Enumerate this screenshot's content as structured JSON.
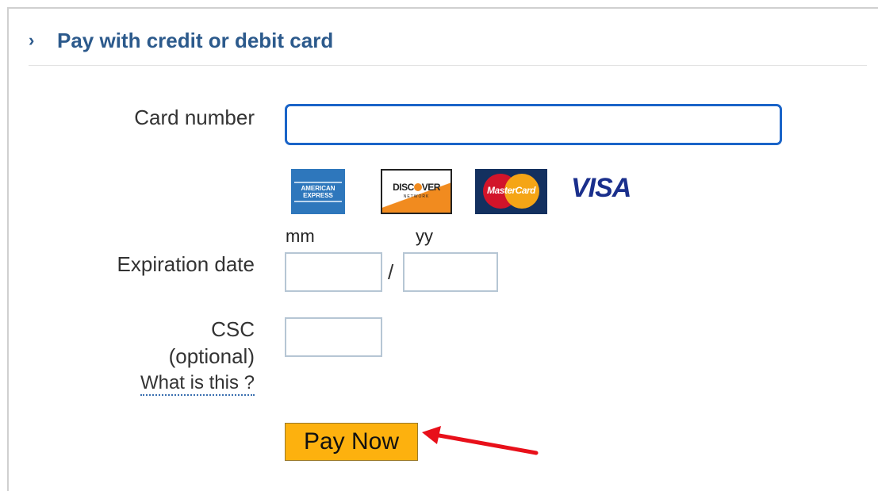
{
  "section": {
    "chevron": "›",
    "title": "Pay with credit or debit card"
  },
  "form": {
    "card_number_label": "Card number",
    "card_number_value": "",
    "expiration_label": "Expiration date",
    "mm_label": "mm",
    "yy_label": "yy",
    "separator": "/",
    "mm_value": "",
    "yy_value": "",
    "csc_label": "CSC",
    "csc_optional": "(optional)",
    "csc_value": "",
    "help_link": "What is this ?",
    "submit_label": "Pay Now"
  },
  "card_logos": {
    "amex": {
      "line1": "AMERICAN",
      "line2": "EXPRESS"
    },
    "discover": {
      "pre": "DISC",
      "post": "VER",
      "sub": "NETWORK"
    },
    "mastercard": "MasterCard",
    "visa": "VISA"
  },
  "colors": {
    "heading": "#2c5a8c",
    "focus_border": "#1a64c8",
    "field_border": "#b6c6d4",
    "button": "#fdb10e",
    "annotation_arrow": "#e8101a"
  },
  "icons": {
    "chevron": "chevron-right-icon",
    "annotation": "red-arrow-icon"
  }
}
